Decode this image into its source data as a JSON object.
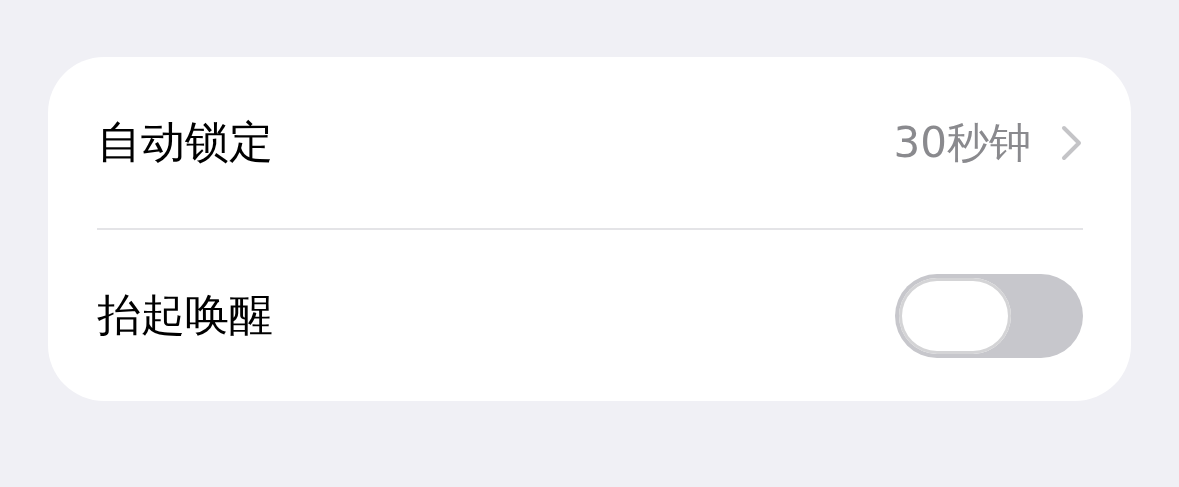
{
  "rows": [
    {
      "kind": "link",
      "label": "自动锁定",
      "value": "30秒钟"
    },
    {
      "kind": "toggle",
      "label": "抬起唤醒",
      "on": false
    }
  ]
}
